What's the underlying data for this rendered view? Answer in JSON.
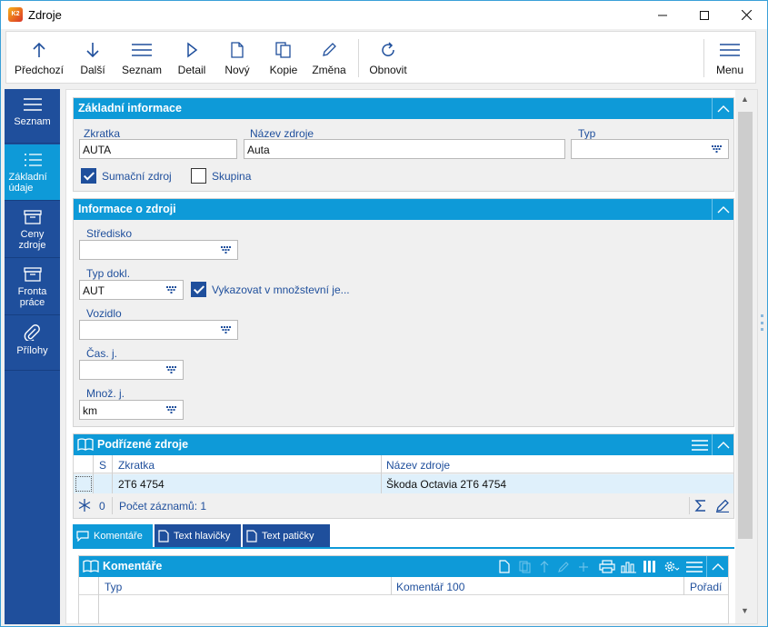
{
  "window": {
    "title": "Zdroje",
    "app_icon_text": "K2"
  },
  "toolbar": {
    "buttons": [
      {
        "label": "Předchozí",
        "icon": "arrow-up-icon"
      },
      {
        "label": "Další",
        "icon": "arrow-down-icon"
      },
      {
        "label": "Seznam",
        "icon": "list-icon"
      },
      {
        "label": "Detail",
        "icon": "play-icon"
      },
      {
        "label": "Nový",
        "icon": "new-document-icon"
      },
      {
        "label": "Kopie",
        "icon": "copy-icon"
      },
      {
        "label": "Změna",
        "icon": "pencil-icon"
      },
      {
        "label": "Obnovit",
        "icon": "refresh-icon"
      }
    ],
    "menu_label": "Menu"
  },
  "leftnav": {
    "items": [
      {
        "label": "Seznam",
        "icon": "list-icon"
      },
      {
        "label": "Základní údaje",
        "icon": "details-icon",
        "active": true
      },
      {
        "label": "Ceny zdroje",
        "icon": "box-icon"
      },
      {
        "label": "Fronta práce",
        "icon": "box-icon"
      },
      {
        "label": "Přílohy",
        "icon": "paperclip-icon"
      }
    ]
  },
  "basic_info": {
    "title": "Základní informace",
    "zkratka_label": "Zkratka",
    "zkratka_value": "AUTA",
    "nazev_label": "Název zdroje",
    "nazev_value": "Auta",
    "typ_label": "Typ",
    "typ_value": "",
    "sumacni_label": "Sumační zdroj",
    "sumacni_checked": true,
    "skupina_label": "Skupina",
    "skupina_checked": false
  },
  "resource_info": {
    "title": "Informace o zdroji",
    "stredisko_label": "Středisko",
    "stredisko_value": "",
    "typdokl_label": "Typ dokl.",
    "typdokl_value": "AUT",
    "vykazovat_label": "Vykazovat v množstevní je...",
    "vykazovat_checked": true,
    "vozidlo_label": "Vozidlo",
    "vozidlo_value": "",
    "casj_label": "Čas. j.",
    "casj_value": "",
    "mnozj_label": "Množ. j.",
    "mnozj_value": "km"
  },
  "sub_resources": {
    "title": "Podřízené zdroje",
    "columns": {
      "s": "S",
      "zkratka": "Zkratka",
      "nazev": "Název zdroje"
    },
    "rows": [
      {
        "zkratka": "2T6 4754",
        "nazev": "Škoda Octavia 2T6 4754"
      }
    ],
    "filter_count": "0",
    "record_count_label": "Počet záznamů: 1"
  },
  "tabs": [
    {
      "label": "Komentáře",
      "active": true
    },
    {
      "label": "Text hlavičky",
      "active": false
    },
    {
      "label": "Text patičky",
      "active": false
    }
  ],
  "comments": {
    "title": "Komentáře",
    "columns": {
      "typ": "Typ",
      "komentar": "Komentář 100",
      "poradi": "Pořadí"
    }
  },
  "colors": {
    "accent": "#0E9AD8",
    "nav": "#1F4F9C",
    "selected_row": "#DFF0FB"
  }
}
